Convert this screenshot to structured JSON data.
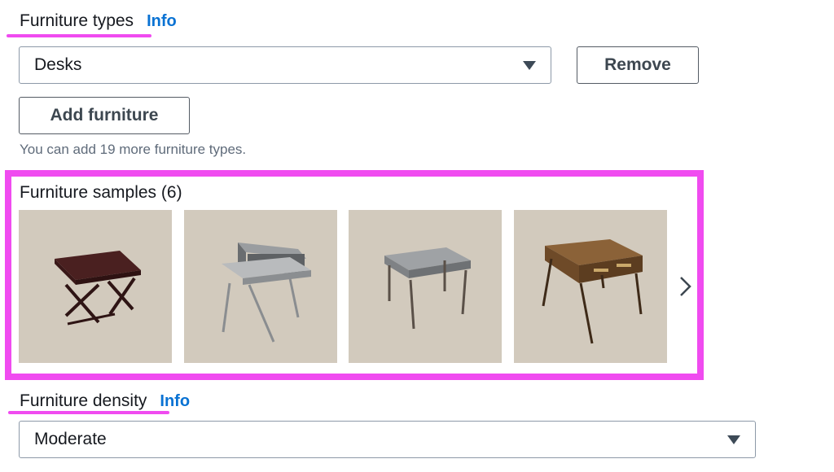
{
  "furniture_types": {
    "label": "Furniture types",
    "info": "Info",
    "selected": "Desks",
    "remove_label": "Remove",
    "add_label": "Add furniture",
    "hint": "You can add 19 more furniture types."
  },
  "samples": {
    "title": "Furniture samples (6)",
    "items": [
      {
        "name": "dark-wood-desk-x-legs"
      },
      {
        "name": "grey-desk-with-hutch"
      },
      {
        "name": "grey-desk-with-drawers"
      },
      {
        "name": "walnut-desk-with-drawers"
      }
    ],
    "next_icon": "chevron-right-icon"
  },
  "furniture_density": {
    "label": "Furniture density",
    "info": "Info",
    "selected": "Moderate"
  },
  "colors": {
    "highlight": "#f04bf0",
    "info_link": "#0972d3",
    "thumb_bg": "#d2cabd"
  }
}
